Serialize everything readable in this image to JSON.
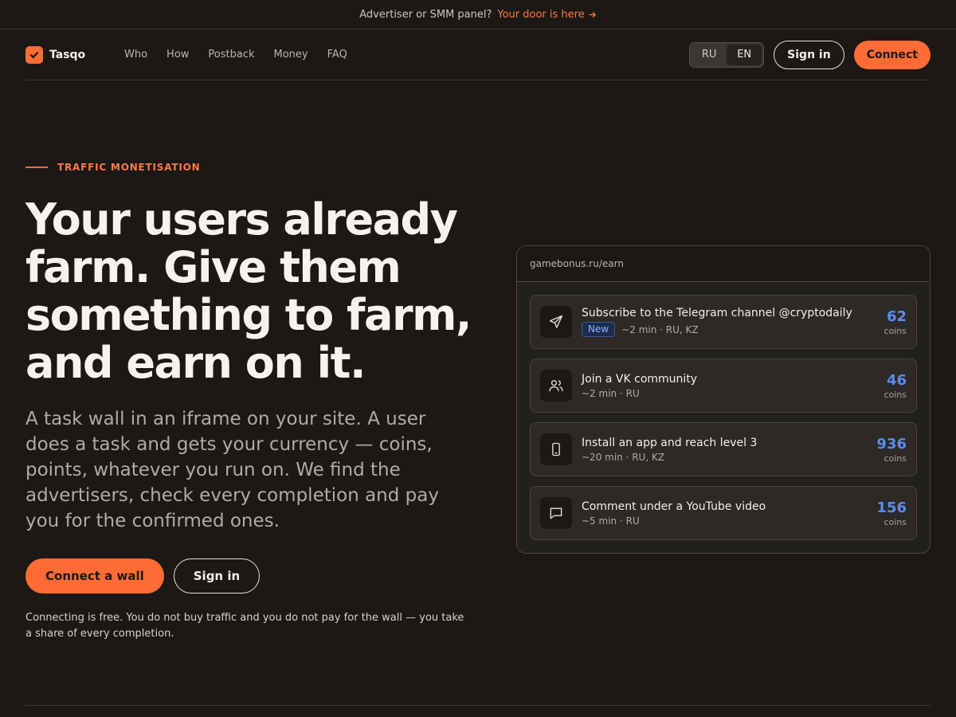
{
  "announcement": {
    "text": "Advertiser or SMM panel?",
    "link": "Your door is here",
    "link_icon": "arrow-right-icon"
  },
  "brand": {
    "name": "Tasqo",
    "icon": "checkmark-icon",
    "accent": "#ff6b35"
  },
  "nav": {
    "links": [
      "Who",
      "How",
      "Postback",
      "Money",
      "FAQ"
    ],
    "languages": [
      "RU",
      "EN"
    ],
    "active_language": "EN",
    "sign_in": "Sign in",
    "connect": "Connect"
  },
  "hero": {
    "eyebrow": "TRAFFIC MONETISATION",
    "headline": "Your users already farm. Give them something to farm, and earn on it.",
    "lead": "A task wall in an iframe on your site. A user does a task and gets your currency — coins, points, whatever you run on. We find the advertisers, check every completion and pay you for the confirmed ones.",
    "primary_cta": "Connect a wall",
    "secondary_cta": "Sign in",
    "footnote": "Connecting is free. You do not buy traffic and you do not pay for the wall — you take a share of every completion."
  },
  "wall": {
    "url": "gamebonus.ru/earn",
    "tasks": [
      {
        "icon": "send-icon",
        "title": "Subscribe to the Telegram channel @cryptodaily",
        "badge": "New",
        "meta": "~2 min · RU, KZ",
        "reward": "62",
        "unit": "coins"
      },
      {
        "icon": "users-icon",
        "title": "Join a VK community",
        "meta": "~2 min · RU",
        "reward": "46",
        "unit": "coins"
      },
      {
        "icon": "smartphone-icon",
        "title": "Install an app and reach level 3",
        "meta": "~20 min · RU, KZ",
        "reward": "936",
        "unit": "coins"
      },
      {
        "icon": "message-icon",
        "title": "Comment under a YouTube video",
        "meta": "~5 min · RU",
        "reward": "156",
        "unit": "coins"
      }
    ]
  }
}
